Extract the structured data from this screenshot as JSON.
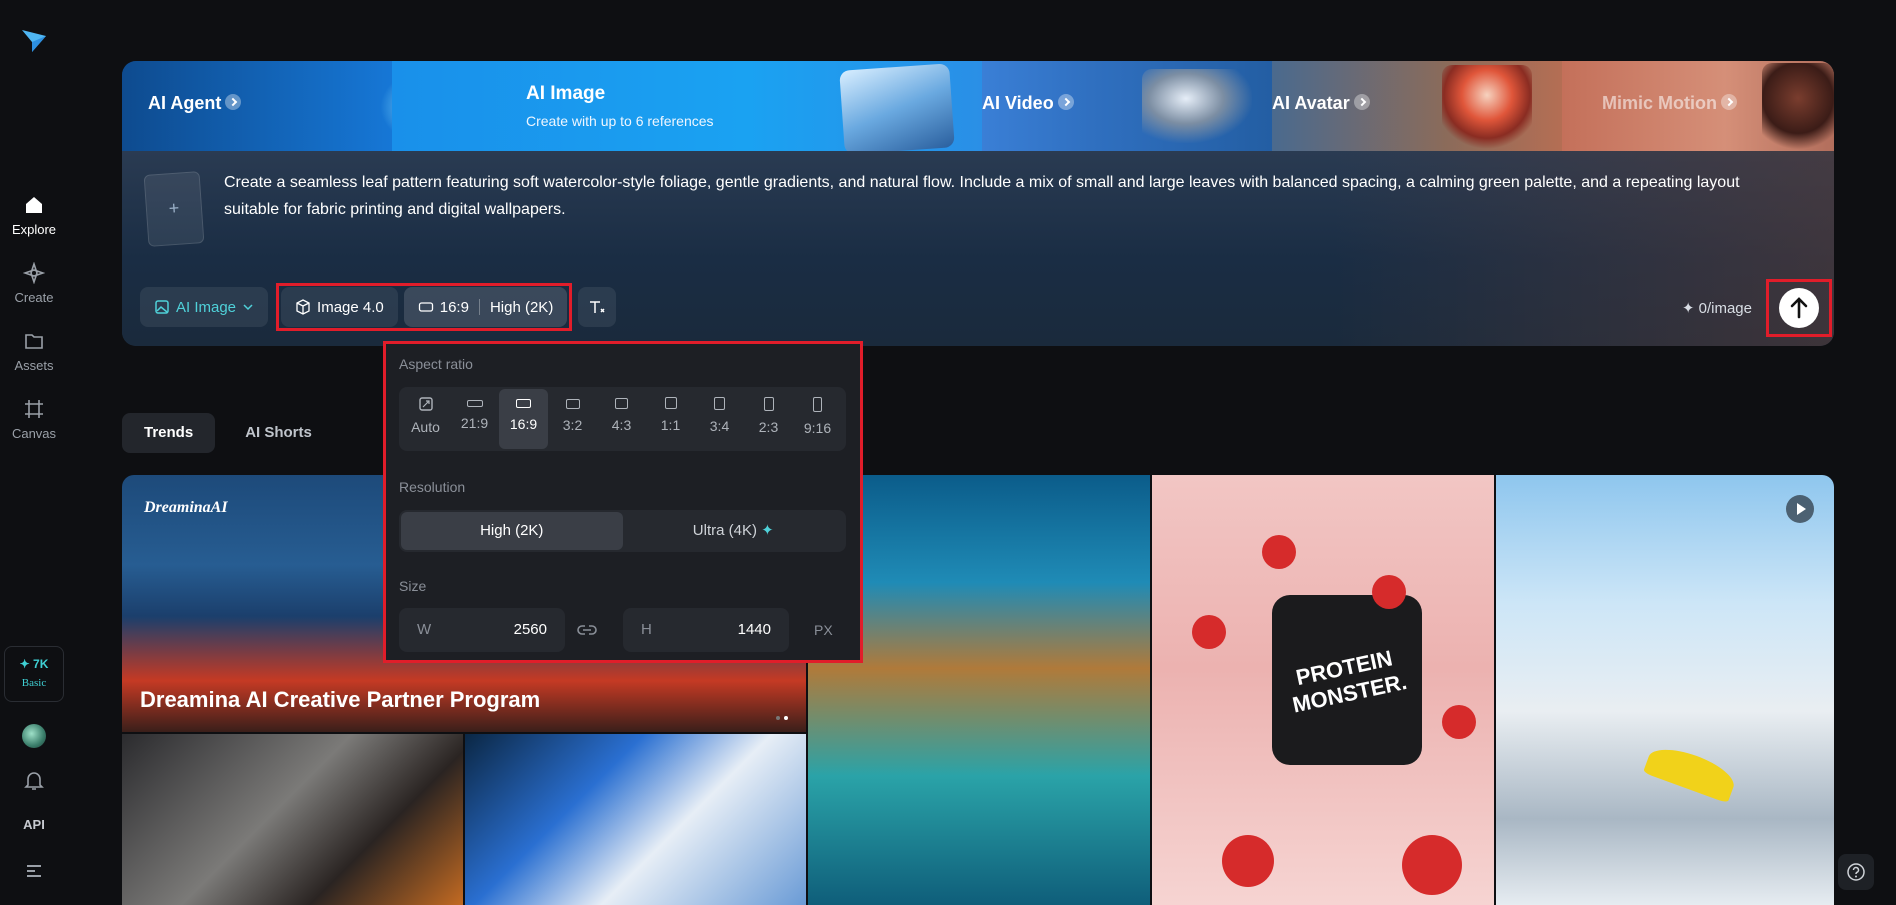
{
  "sidebar": {
    "items": [
      {
        "label": "Explore",
        "icon": "home-icon"
      },
      {
        "label": "Create",
        "icon": "sparkle-icon"
      },
      {
        "label": "Assets",
        "icon": "folder-icon"
      },
      {
        "label": "Canvas",
        "icon": "canvas-icon"
      }
    ],
    "credits": {
      "amount": "✦ 7K",
      "plan": "Basic"
    },
    "api_label": "API"
  },
  "banner": {
    "agent": "AI Agent",
    "image_title": "AI Image",
    "image_subtitle": "Create with up to 6 references",
    "video": "AI Video",
    "avatar": "AI Avatar",
    "mimic": "Mimic Motion"
  },
  "prompt": {
    "text": "Create a seamless leaf pattern featuring soft watercolor-style foliage, gentle gradients, and natural flow. Include a mix of small and large leaves with balanced spacing, a calming green palette, and a repeating layout suitable for fabric printing and digital wallpapers.",
    "add_icon": "+"
  },
  "toolbar": {
    "mode": "AI Image",
    "model": "Image 4.0",
    "ratio": "16:9",
    "resolution": "High (2K)",
    "price": "✦ 0/image"
  },
  "popover": {
    "aspect_heading": "Aspect ratio",
    "ratios": [
      "Auto",
      "21:9",
      "16:9",
      "3:2",
      "4:3",
      "1:1",
      "3:4",
      "2:3",
      "9:16"
    ],
    "selected_ratio": "16:9",
    "resolution_heading": "Resolution",
    "resolution_options": [
      "High (2K)",
      "Ultra (4K)"
    ],
    "ultra_badge": "✦",
    "size_heading": "Size",
    "width_label": "W",
    "width_value": "2560",
    "height_label": "H",
    "height_value": "1440",
    "unit": "PX"
  },
  "tabs": [
    "Trends",
    "AI Shorts"
  ],
  "gallery": {
    "promo_logo": "DreaminaAI",
    "promo_title": "Dreamina AI Creative Partner Program",
    "jar_label": "PROTEIN MONSTER."
  },
  "colors": {
    "accent": "#4fd1d9",
    "highlight": "#e11d2a",
    "background": "#0e0f12"
  }
}
